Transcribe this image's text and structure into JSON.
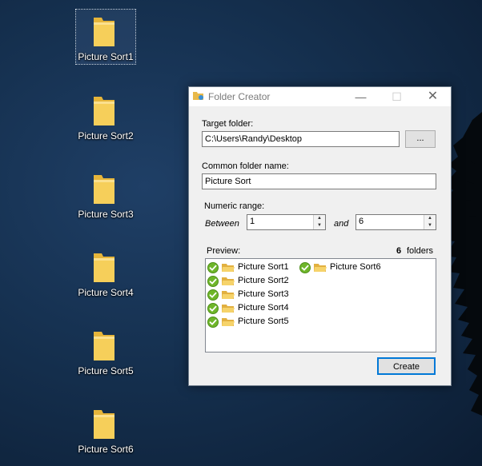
{
  "desktop": {
    "icons": [
      {
        "label": "Picture Sort1"
      },
      {
        "label": "Picture Sort2"
      },
      {
        "label": "Picture Sort3"
      },
      {
        "label": "Picture Sort4"
      },
      {
        "label": "Picture Sort5"
      },
      {
        "label": "Picture Sort6"
      }
    ]
  },
  "dialog": {
    "title": "Folder Creator",
    "buttons": {
      "minimize": "—",
      "maximize": "☐",
      "close": "✕",
      "browse": "...",
      "create": "Create"
    },
    "target_folder": {
      "label": "Target folder:",
      "value": "C:\\Users\\Randy\\Desktop"
    },
    "common_name": {
      "label": "Common folder name:",
      "value": "Picture Sort"
    },
    "numeric_range": {
      "label": "Numeric range:",
      "between_label": "Between",
      "and_label": "and",
      "from": "1",
      "to": "6"
    },
    "preview": {
      "label": "Preview:",
      "count": "6",
      "count_suffix": "folders",
      "items": [
        "Picture Sort1",
        "Picture Sort2",
        "Picture Sort3",
        "Picture Sort4",
        "Picture Sort5",
        "Picture Sort6"
      ]
    }
  },
  "colors": {
    "check_green": "#6fb62a",
    "folder_yellow": "#f3c34a",
    "accent": "#0078d7"
  }
}
